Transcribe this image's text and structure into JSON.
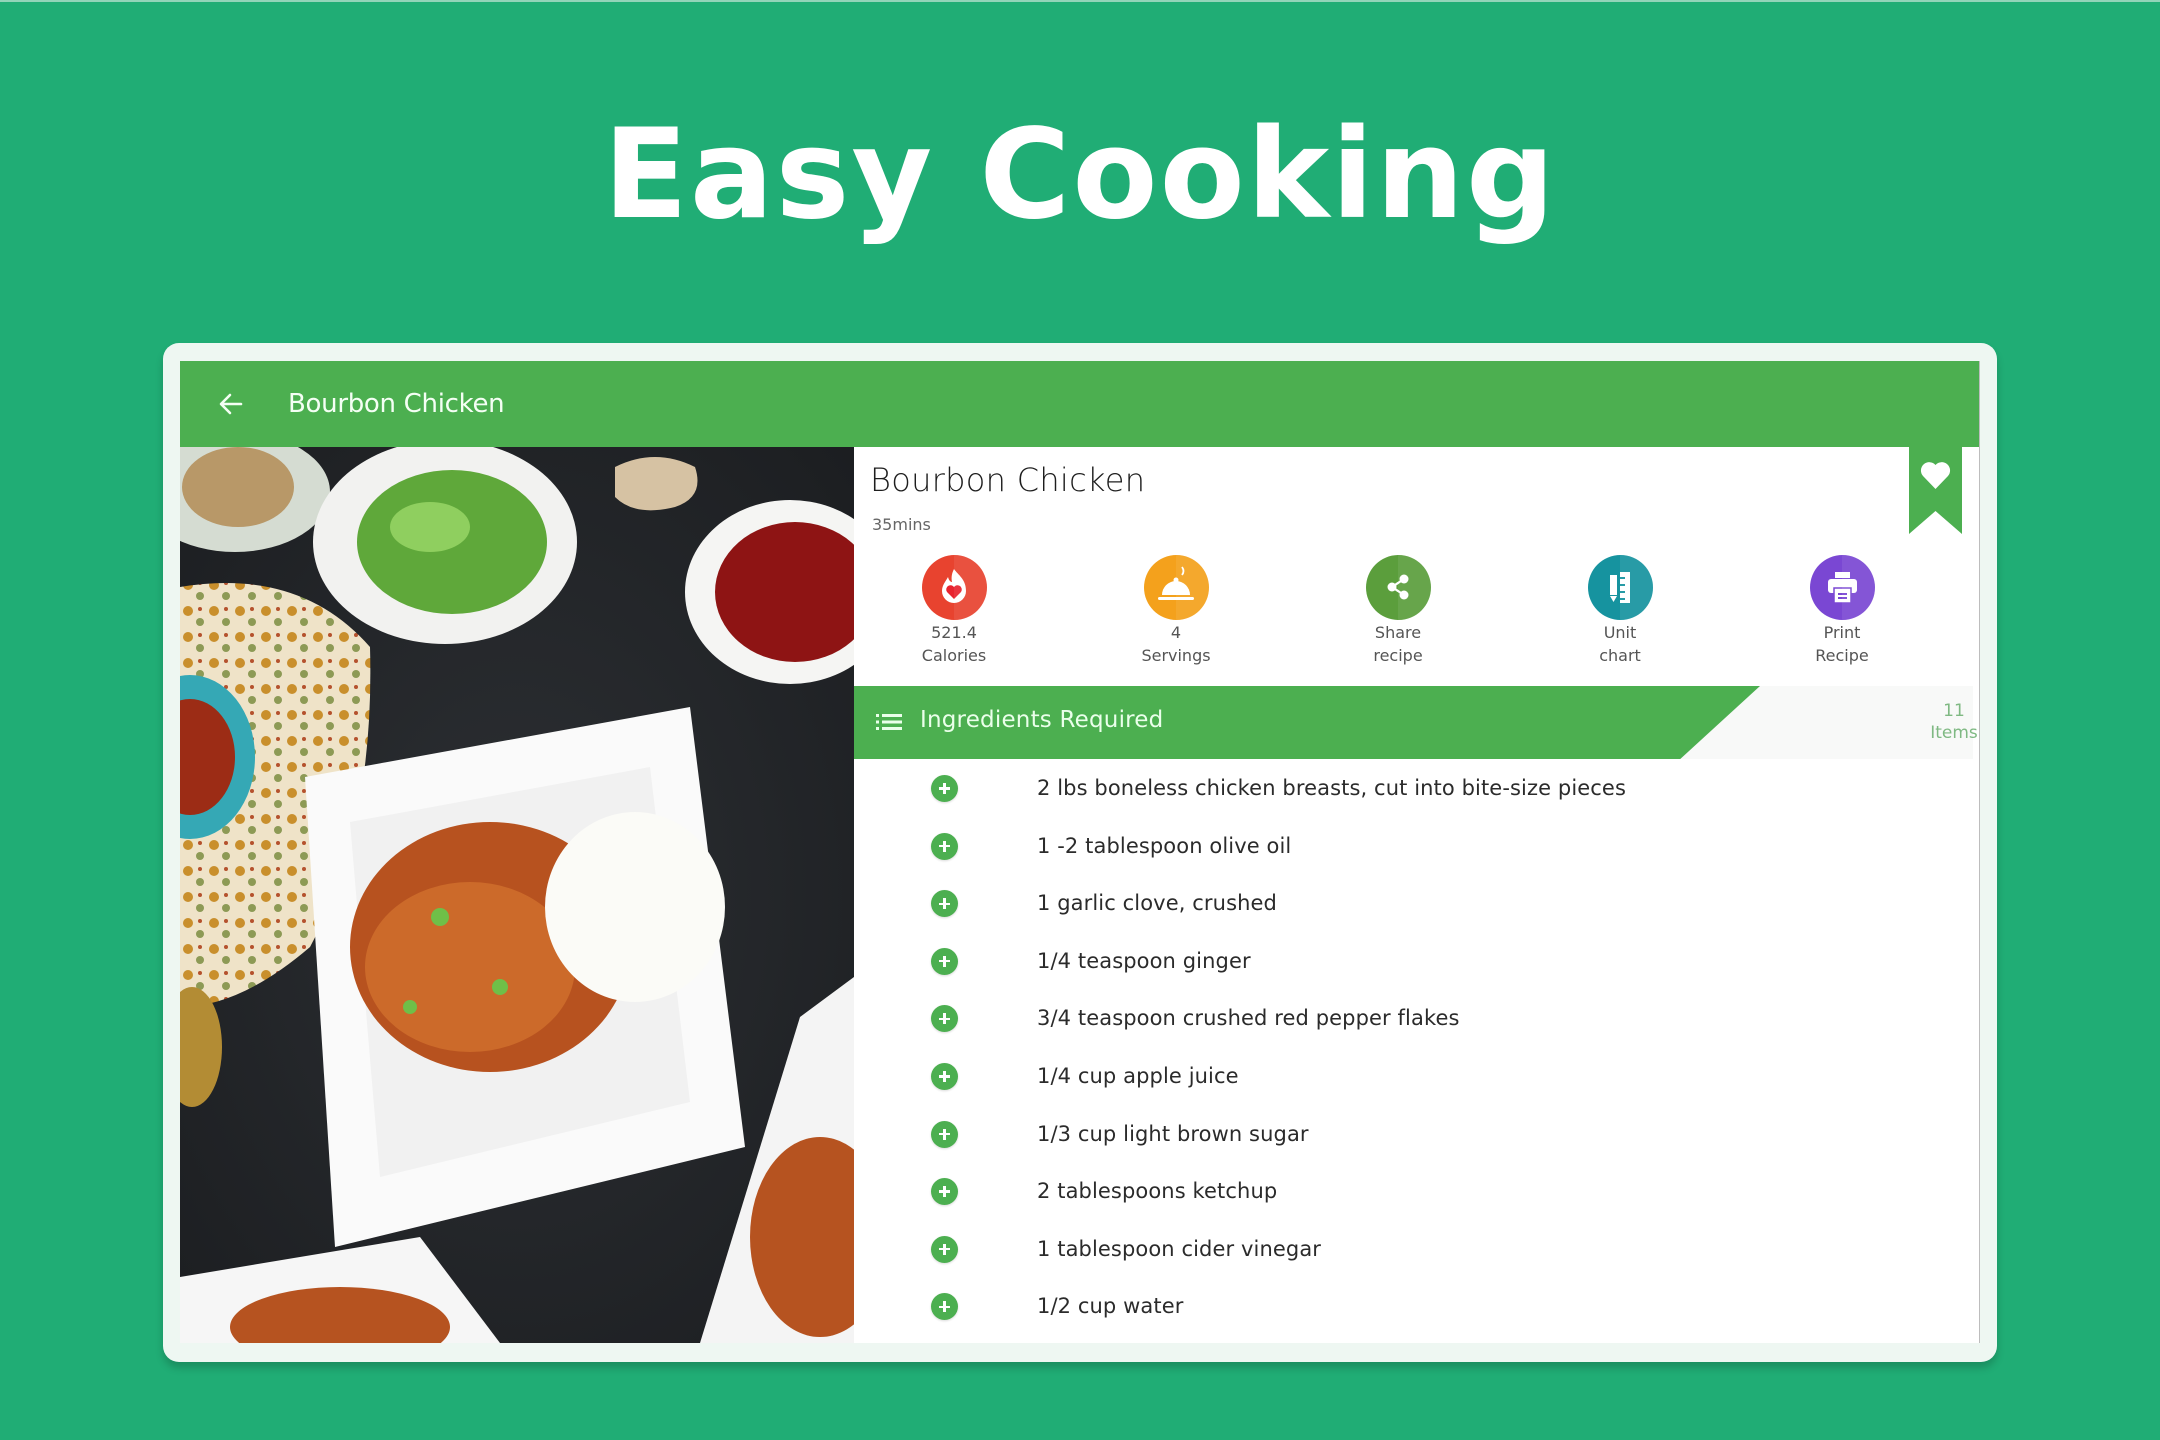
{
  "hero": {
    "title": "Easy Cooking"
  },
  "colors": {
    "background": "#20ad75",
    "toolbar": "#4caf50",
    "calories": "#e8432f",
    "servings": "#f4a11c",
    "share": "#5b9e3c",
    "unit_chart": "#16939f",
    "print": "#7a47d3"
  },
  "toolbar": {
    "back_icon": "arrow-left-icon",
    "title": "Bourbon Chicken"
  },
  "recipe": {
    "title": "Bourbon Chicken",
    "time": "35mins",
    "bookmark_icon": "heart-bookmark-icon",
    "image_alt": "Bourbon chicken with rice in a white square bowl"
  },
  "actions": [
    {
      "icon": "calories-flame-heart-icon",
      "line1": "521.4",
      "line2": "Calories"
    },
    {
      "icon": "serving-cloche-icon",
      "line1": "4",
      "line2": "Servings"
    },
    {
      "icon": "share-icon",
      "line1": "Share",
      "line2": "recipe"
    },
    {
      "icon": "ruler-pencil-icon",
      "line1": "Unit",
      "line2": "chart"
    },
    {
      "icon": "printer-icon",
      "line1": "Print",
      "line2": "Recipe"
    }
  ],
  "ingredients": {
    "header": "Ingredients Required",
    "count": "11",
    "count_label": "Items",
    "items": [
      "2 lbs boneless chicken breasts, cut into bite-size pieces",
      "1 -2 tablespoon olive oil",
      "1 garlic clove, crushed",
      "1/4 teaspoon ginger",
      "3/4 teaspoon crushed red pepper flakes",
      "1/4 cup apple juice",
      "1/3 cup light brown sugar",
      "2 tablespoons ketchup",
      "1 tablespoon cider vinegar",
      "1/2 cup water"
    ]
  }
}
